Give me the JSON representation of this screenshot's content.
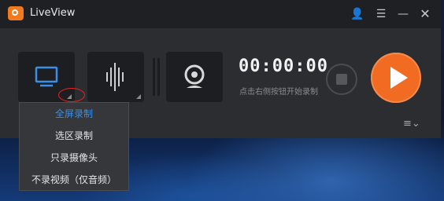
{
  "app": {
    "title": "LiveView"
  },
  "titlebar": {
    "icons": [
      "user-icon",
      "menu-icon",
      "minimize-icon",
      "close-icon"
    ],
    "glyphs": {
      "user": "👤",
      "menu": "☰",
      "minimize": "—",
      "close": "✕"
    }
  },
  "recorder": {
    "timer": "00:00:00",
    "hint": "点击右侧按钮开始录制",
    "accent_color": "#f26b22",
    "selected_color": "#3b8fe6",
    "list_glyph": "≡⌄"
  },
  "dropdown": {
    "items": [
      {
        "label": "全屏录制",
        "selected": true
      },
      {
        "label": "选区录制",
        "selected": false
      },
      {
        "label": "只录摄像头",
        "selected": false
      },
      {
        "label": "不录视频（仅音频）",
        "selected": false
      }
    ]
  }
}
